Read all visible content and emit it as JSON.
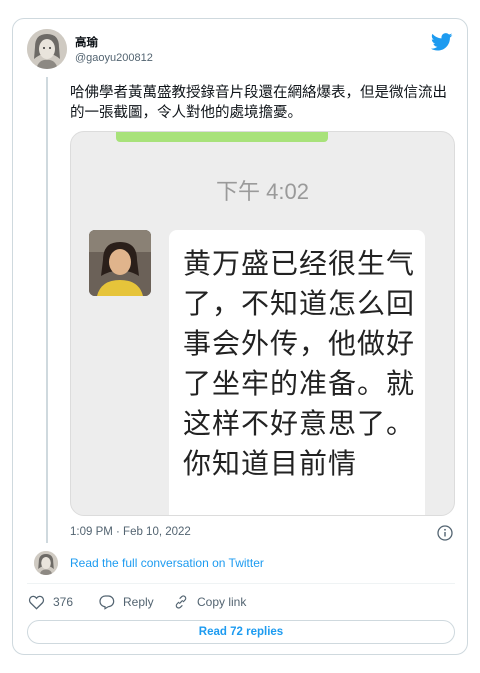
{
  "author": {
    "name": "高瑜",
    "handle": "@gaoyu200812"
  },
  "tweet": {
    "text": "哈佛學者黃萬盛教授錄音片段還在網絡爆表，但是微信流出的一張截圖，令人對他的處境擔憂。",
    "timestamp": "1:09 PM · Feb 10, 2022"
  },
  "media": {
    "chat_time": "下午 4:02",
    "message": "黄万盛已经很生气了，不知道怎么回事会外传，他做好了坐牢的准备。就这样不好意思了。你知道目前情"
  },
  "conversation_link": "Read the full conversation on Twitter",
  "actions": {
    "like_count": "376",
    "reply_label": "Reply",
    "copy_label": "Copy link"
  },
  "read_replies": "Read 72 replies",
  "colors": {
    "twitter_blue": "#1d9bf0",
    "text": "#0f1419",
    "muted": "#536471",
    "wechat_green": "#a8e27a"
  },
  "icons": [
    "twitter-logo-icon",
    "info-icon",
    "heart-icon",
    "reply-bubble-icon",
    "link-icon"
  ]
}
